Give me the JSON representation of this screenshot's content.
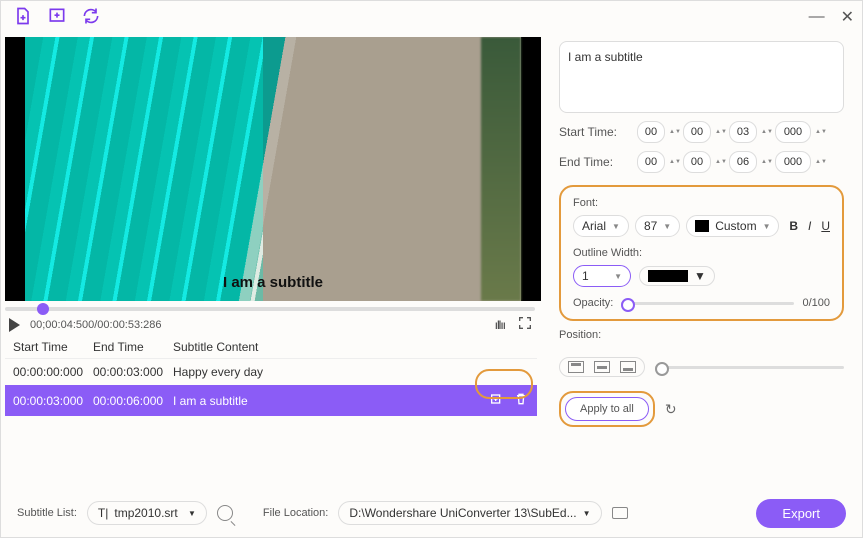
{
  "toolbar": {
    "icon1": "add-file-icon",
    "icon2": "add-clip-icon",
    "icon3": "refresh-sync-icon"
  },
  "window": {
    "minimize": "—",
    "close": "✕"
  },
  "preview": {
    "subtitle_text": "I am a subtitle"
  },
  "playback": {
    "time": "00;00:04:500/00:00:53:286"
  },
  "table": {
    "headers": {
      "start": "Start Time",
      "end": "End Time",
      "content": "Subtitle Content"
    },
    "rows": [
      {
        "start": "00:00:00:000",
        "end": "00:00:03:000",
        "content": "Happy every day"
      },
      {
        "start": "00:00:03:000",
        "end": "00:00:06:000",
        "content": "I am a subtitle"
      }
    ]
  },
  "editor": {
    "text": "I am a subtitle",
    "start_label": "Start Time:",
    "end_label": "End Time:",
    "start": {
      "h": "00",
      "m": "00",
      "s": "03",
      "ms": "000"
    },
    "end": {
      "h": "00",
      "m": "00",
      "s": "06",
      "ms": "000"
    },
    "font_label": "Font:",
    "font_family": "Arial",
    "font_size": "87",
    "color_mode": "Custom",
    "outline_label": "Outline Width:",
    "outline_width": "1",
    "opacity_label": "Opacity:",
    "opacity_value": "0/100",
    "position_label": "Position:",
    "apply_label": "Apply to all"
  },
  "footer": {
    "list_label": "Subtitle List:",
    "list_file": "tmp2010.srt",
    "location_label": "File Location:",
    "location_path": "D:\\Wondershare UniConverter 13\\SubEd...",
    "export": "Export"
  }
}
